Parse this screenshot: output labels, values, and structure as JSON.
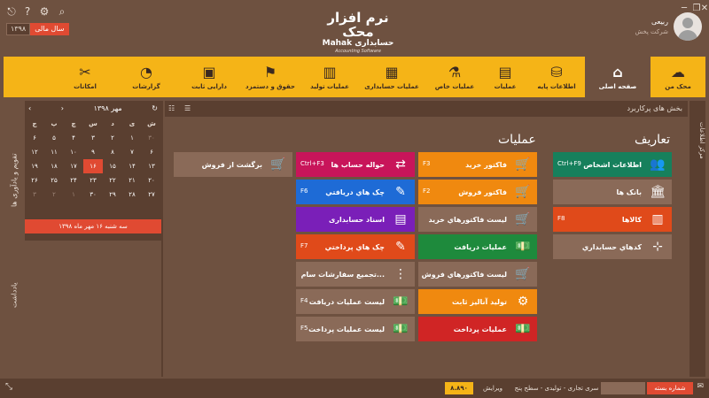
{
  "window": {
    "icons": [
      "minimize-icon",
      "restore-icon",
      "close-icon"
    ]
  },
  "toolbar": {
    "icons": [
      "logout-icon",
      "help-icon",
      "settings-icon",
      "search-icon"
    ]
  },
  "fiscal_year": {
    "value": "۱۳۹۸",
    "label": "سال مالی"
  },
  "logo": {
    "line1": "نرم افزار محک",
    "line2": "Mahak حسابداری",
    "line3": "Accounting Software"
  },
  "user": {
    "name": "ربیعی",
    "company": "شرکت پخش"
  },
  "ribbon": {
    "tabs": [
      {
        "label": "محک من",
        "icon": "☁"
      },
      {
        "label": "صفحه اصلی",
        "icon": "⌂",
        "active": true
      },
      {
        "label": "اطلاعات پایه",
        "icon": "⛁"
      },
      {
        "label": "عملیات",
        "icon": "▤"
      },
      {
        "label": "عملیات خاص",
        "icon": "⚗"
      },
      {
        "label": "عملیات حسابداری",
        "icon": "▦"
      },
      {
        "label": "عملیات تولید",
        "icon": "▥"
      },
      {
        "label": "حقوق و دستمزد",
        "icon": "⚑"
      },
      {
        "label": "دارایی ثابت",
        "icon": "▣"
      },
      {
        "label": "گزارشات",
        "icon": "◔"
      },
      {
        "label": "امکانات",
        "icon": "✂"
      }
    ]
  },
  "left": {
    "tabs": {
      "calendar": "تقویم و یادآوری ها",
      "notes": "یادداشت"
    },
    "calendar": {
      "month": "مهر ۱۳۹۸",
      "weekdays": [
        "ش",
        "ی",
        "د",
        "س",
        "چ",
        "پ",
        "ج"
      ],
      "weeks": [
        [
          {
            "d": "۳۰",
            "dim": true
          },
          {
            "d": "۱"
          },
          {
            "d": "۲"
          },
          {
            "d": "۳"
          },
          {
            "d": "۴"
          },
          {
            "d": "۵"
          },
          {
            "d": "۶"
          }
        ],
        [
          {
            "d": "۶"
          },
          {
            "d": "۷"
          },
          {
            "d": "۸"
          },
          {
            "d": "۹"
          },
          {
            "d": "۱۰"
          },
          {
            "d": "۱۱"
          },
          {
            "d": "۱۲"
          }
        ],
        [
          {
            "d": "۱۳"
          },
          {
            "d": "۱۴"
          },
          {
            "d": "۱۵"
          },
          {
            "d": "۱۶",
            "today": true
          },
          {
            "d": "۱۷"
          },
          {
            "d": "۱۸"
          },
          {
            "d": "۱۹"
          }
        ],
        [
          {
            "d": "۲۰"
          },
          {
            "d": "۲۱"
          },
          {
            "d": "۲۲"
          },
          {
            "d": "۲۳"
          },
          {
            "d": "۲۴"
          },
          {
            "d": "۲۵"
          },
          {
            "d": "۲۶"
          }
        ],
        [
          {
            "d": "۲۷"
          },
          {
            "d": "۲۸"
          },
          {
            "d": "۲۹"
          },
          {
            "d": "۳۰"
          },
          {
            "d": "۱",
            "dim": true
          },
          {
            "d": "۲",
            "dim": true
          },
          {
            "d": "۳",
            "dim": true
          }
        ]
      ],
      "today_text": "سه شنبه ۱۶ مهر ماه ۱۳۹۸"
    }
  },
  "main": {
    "header": "بخش های پرکاربرد",
    "sections": {
      "definitions": "تعاریف",
      "operations": "عملیات"
    },
    "definitions": [
      {
        "label": "اطلاعات اشخاص",
        "key": "Ctrl+F9",
        "color": "#16805c",
        "icon": "👥"
      },
      {
        "label": "بانک ها",
        "key": "",
        "color": "#8a6a58",
        "icon": "🏛"
      },
      {
        "label": "کالاها",
        "key": "F8",
        "color": "#e04a1a",
        "icon": "▥"
      },
      {
        "label": "کدهاي حسابداري",
        "key": "",
        "color": "#8a6a58",
        "icon": "⊹"
      }
    ],
    "ops_col1": [
      {
        "label": "فاکتور خرید",
        "key": "F3",
        "color": "#f0890f",
        "icon": "🛒"
      },
      {
        "label": "فاکتور فروش",
        "key": "F2",
        "color": "#f0890f",
        "icon": "🛒"
      },
      {
        "label": "لیست فاکتورهاي خرید",
        "key": "",
        "color": "#8a6a58",
        "icon": "🛒"
      },
      {
        "label": "عملیات دریافت",
        "key": "",
        "color": "#1e8a3c",
        "icon": "💵"
      },
      {
        "label": "لیست فاکتورهاي فروش",
        "key": "",
        "color": "#8a6a58",
        "icon": "🛒"
      },
      {
        "label": "تولید آنالیز ثابت",
        "key": "",
        "color": "#f0890f",
        "icon": "⚙"
      },
      {
        "label": "عملیات پرداخت",
        "key": "",
        "color": "#d02525",
        "icon": "💵"
      }
    ],
    "ops_col2": [
      {
        "label": "حواله حساب ها",
        "key": "Ctrl+F3",
        "color": "#c8155a",
        "icon": "⇄"
      },
      {
        "label": "چک هاي دریافتي",
        "key": "F6",
        "color": "#1e6bd6",
        "icon": "✎"
      },
      {
        "label": "اسناد حسابداری",
        "key": "",
        "color": "#7a1fb8",
        "icon": "▤"
      },
      {
        "label": "چک هاي پرداختي",
        "key": "F7",
        "color": "#e04a1a",
        "icon": "✎"
      },
      {
        "label": "تجمیع سفارشات سام...",
        "key": "",
        "color": "#8a6a58",
        "icon": "⋮"
      },
      {
        "label": "لیست عملیات دریافت",
        "key": "F4",
        "color": "#8a6a58",
        "icon": "💵"
      },
      {
        "label": "لیست عملیات پرداخت",
        "key": "F5",
        "color": "#8a6a58",
        "icon": "💵"
      }
    ],
    "ops_col3": [
      {
        "label": "برگشت از فروش",
        "key": "",
        "color": "#8a6a58",
        "icon": "🛒"
      }
    ]
  },
  "rightbar": {
    "label": "مرکز اطلاعات"
  },
  "status": {
    "serial_label": "شماره بسته",
    "edition": "سری تجاری - تولیدی - سطح پنج",
    "version_label": "ویرایش",
    "version": "۸.۸۹۰"
  }
}
